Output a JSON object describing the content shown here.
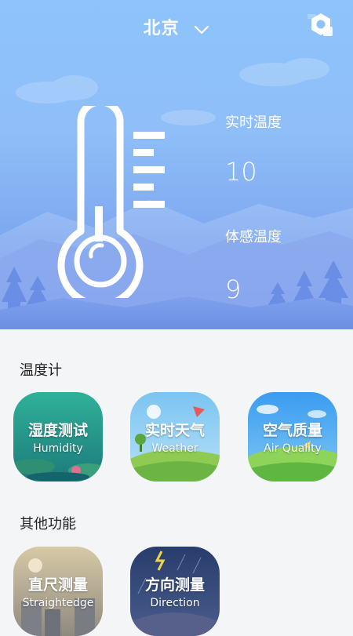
{
  "header": {
    "city": "北京",
    "dropdown_icon": "chevron-down-icon",
    "settings_icon": "settings-hexagon-icon"
  },
  "hero": {
    "realtime_label": "实时温度",
    "realtime_value": "10",
    "feels_label": "体感温度",
    "feels_value": "9",
    "thermometer_icon": "thermometer-icon"
  },
  "sections": [
    {
      "title": "温度计",
      "tiles": [
        {
          "zh": "湿度测试",
          "en": "Humidity"
        },
        {
          "zh": "实时天气",
          "en": "Weather"
        },
        {
          "zh": "空气质量",
          "en": "Air Quality"
        }
      ]
    },
    {
      "title": "其他功能",
      "tiles": [
        {
          "zh": "直尺测量",
          "en": "Straightedge"
        },
        {
          "zh": "方向测量",
          "en": "Direction"
        }
      ]
    }
  ]
}
